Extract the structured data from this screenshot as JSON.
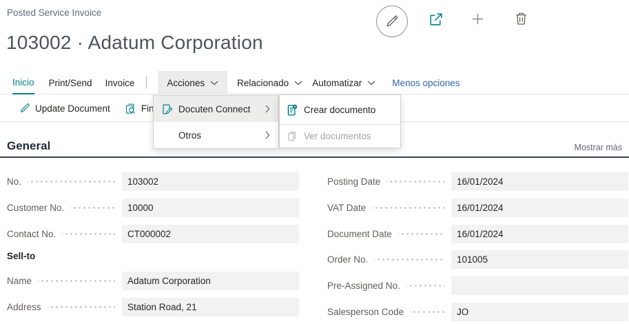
{
  "page": {
    "caption": "Posted Service Invoice",
    "title": "103002 · Adatum Corporation"
  },
  "top_actions": {
    "icons": [
      "edit-icon",
      "share-icon",
      "add-icon",
      "delete-icon"
    ]
  },
  "tabs": [
    {
      "label": "Inicio",
      "active": true
    },
    {
      "label": "Print/Send"
    },
    {
      "label": "Invoice"
    },
    {
      "label": "Acciones",
      "dropdown": true,
      "open": true
    },
    {
      "label": "Relacionado",
      "dropdown": true
    },
    {
      "label": "Automatizar",
      "dropdown": true
    },
    {
      "label": "Menos opciones",
      "link": true
    }
  ],
  "action_bar": {
    "update_document_label": "Update Document",
    "find_entries_partial_label": "Fin"
  },
  "actions_menu": {
    "items": [
      {
        "label": "Docuten Connect",
        "icon": "edit-document-icon",
        "has_submenu": true,
        "highlighted": true
      },
      {
        "label": "Otros",
        "has_submenu": true
      }
    ],
    "submenu": {
      "items": [
        {
          "label": "Crear documento",
          "icon": "create-document-icon",
          "enabled": true
        },
        {
          "label": "Ver documentos",
          "icon": "documents-icon",
          "enabled": false
        }
      ]
    }
  },
  "general": {
    "heading": "General",
    "show_more_label": "Mostrar más",
    "left_fields": [
      {
        "label": "No.",
        "value": "103002"
      },
      {
        "label": "Customer No.",
        "value": "10000"
      },
      {
        "label": "Contact No.",
        "value": "CT000002"
      },
      {
        "label": "Name",
        "value": "Adatum Corporation"
      },
      {
        "label": "Address",
        "value": "Station Road, 21"
      }
    ],
    "group_label": "Sell-to",
    "right_fields": [
      {
        "label": "Posting Date",
        "value": "16/01/2024"
      },
      {
        "label": "VAT Date",
        "value": "16/01/2024"
      },
      {
        "label": "Document Date",
        "value": "16/01/2024"
      },
      {
        "label": "Order No.",
        "value": "101005"
      },
      {
        "label": "Pre-Assigned No.",
        "value": ""
      },
      {
        "label": "Salesperson Code",
        "value": "JO"
      }
    ]
  },
  "colors": {
    "accent_teal": "#008089",
    "link_blue": "#2f66ad",
    "section_divider": "#394252",
    "field_background": "#f2f2f2"
  }
}
